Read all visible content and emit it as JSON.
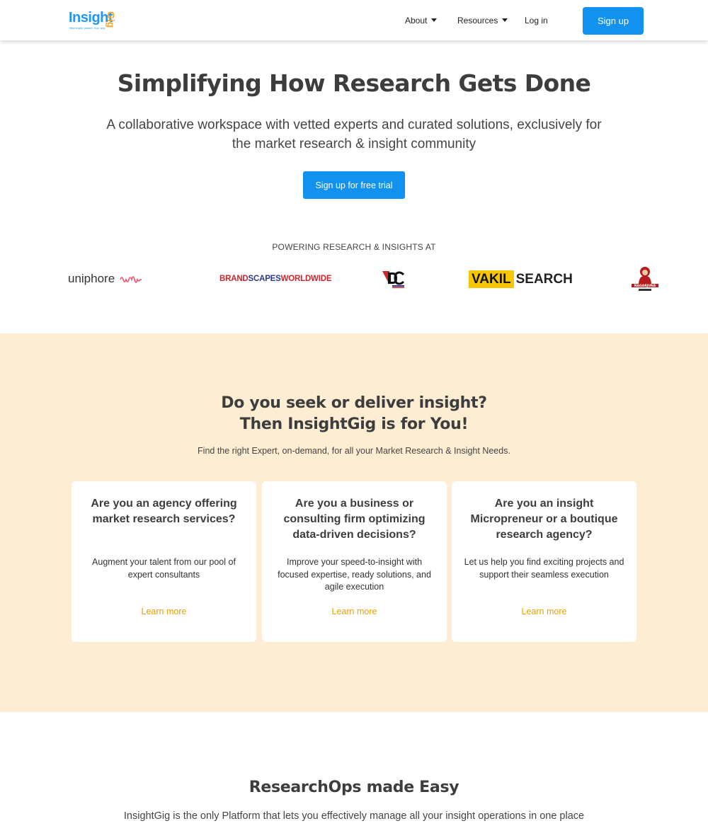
{
  "header": {
    "logo_text": "Insight",
    "logo_accent": "Gig",
    "logo_tagline": "Meaningful growth. Your way.",
    "nav": {
      "about": "About",
      "resources": "Resources",
      "login": "Log in"
    },
    "signup": "Sign up"
  },
  "hero": {
    "title": "Simplifying How Research Gets Done",
    "subtitle": "A collaborative workspace with vetted experts and curated solutions, exclusively for the market research & insight community",
    "cta": "Sign up for free trial"
  },
  "clients": {
    "heading": "POWERING RESEARCH & INSIGHTS AT",
    "uniphore": "uniphore",
    "brandscapes": {
      "part1": "BRAND",
      "part2": "SCAPES",
      "part3": "WORLDWIDE"
    },
    "vakil": {
      "part1": "VAKIL",
      "part2": "SEARCH"
    },
    "nagarjuna": "NAGARJUNA"
  },
  "audience": {
    "title_line1": "Do you seek or deliver insight?",
    "title_line2": "Then InsightGig is for You!",
    "subtitle": "Find the right Expert, on-demand, for all your Market Research & Insight Needs.",
    "cards": [
      {
        "title": "Are you an agency offering market research services?",
        "text": "Augment your talent from our pool of expert consultants",
        "link": "Learn more"
      },
      {
        "title": "Are you a business or consulting firm optimizing data-driven decisions?",
        "text": "Improve your speed-to-insight with focused expertise, ready solutions, and agile execution",
        "link": "Learn more"
      },
      {
        "title": "Are you an insight Micropreneur or a boutique research agency?",
        "text": "Let us help you find exciting projects and support their seamless execution",
        "link": "Learn more"
      }
    ]
  },
  "ops": {
    "title": "ResearchOps made Easy",
    "subtitle": "InsightGig is the only Platform that lets you effectively manage all your insight operations in one place"
  },
  "colors": {
    "primary": "#1391ee",
    "accent": "#e8a100",
    "band_bg": "#fdedd3"
  }
}
